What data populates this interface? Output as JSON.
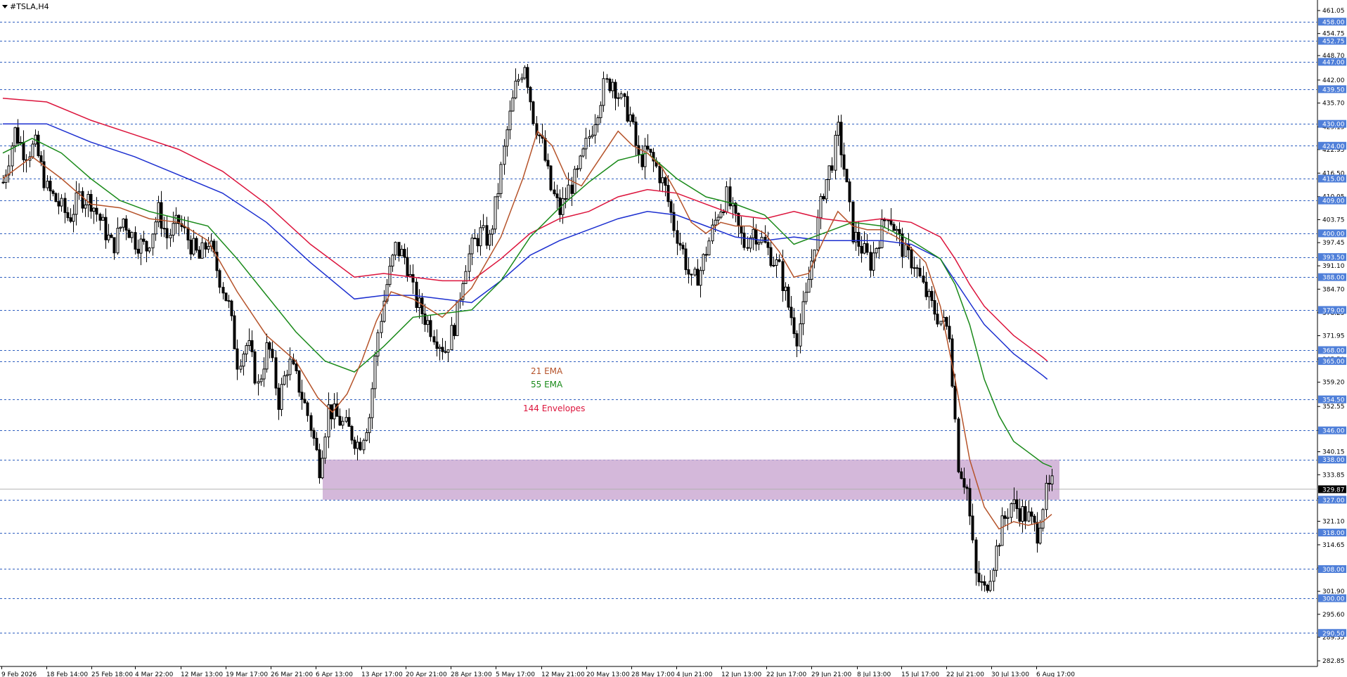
{
  "window": {
    "symbol_title": "#TSLA,H4"
  },
  "colors": {
    "background": "#ffffff",
    "grid_dashed": "#2f5fbf",
    "label_box": "#4f7fd9",
    "ema21": "#b5532a",
    "ema55": "#1a8a1a",
    "env_upper": "#dc143c",
    "env_lower": "#1c2fd0",
    "zone": "#c9a6d1",
    "candle": "#000000"
  },
  "chart_data": {
    "type": "candlestick",
    "symbol": "#TSLA",
    "timeframe": "H4",
    "ylim": [
      282.85,
      461.05
    ],
    "price_axis_ticks": [
      "461.05",
      "454.75",
      "448.70",
      "442.00",
      "435.70",
      "429.15",
      "422.95",
      "416.50",
      "410.05",
      "403.75",
      "397.45",
      "391.10",
      "384.70",
      "378.25",
      "371.95",
      "365.50",
      "359.20",
      "352.55",
      "346.00",
      "340.15",
      "333.85",
      "327.35",
      "321.10",
      "314.65",
      "308.30",
      "301.90",
      "295.60",
      "289.35",
      "282.85"
    ],
    "horizontal_levels": [
      "458.00",
      "452.75",
      "447.00",
      "439.50",
      "430.00",
      "424.00",
      "415.00",
      "409.00",
      "400.00",
      "393.50",
      "388.00",
      "379.00",
      "368.00",
      "365.00",
      "354.50",
      "346.00",
      "338.00",
      "327.00",
      "318.00",
      "308.00",
      "300.00",
      "290.50"
    ],
    "current_price": "329.87",
    "time_axis_labels": [
      "9 Feb 2026",
      "18 Feb 14:00",
      "25 Feb 18:00",
      "4 Mar 22:00",
      "12 Mar 13:00",
      "19 Mar 17:00",
      "26 Mar 21:00",
      "6 Apr 13:00",
      "13 Apr 17:00",
      "20 Apr 21:00",
      "28 Apr 13:00",
      "5 May 17:00",
      "12 May 21:00",
      "20 May 13:00",
      "28 May 17:00",
      "4 Jun 21:00",
      "12 Jun 13:00",
      "22 Jun 17:00",
      "29 Jun 21:00",
      "8 Jul 13:00",
      "15 Jul 17:00",
      "22 Jul 21:00",
      "30 Jul 13:00",
      "6 Aug 17:00"
    ],
    "zone": {
      "price_low": 327.0,
      "price_high": 338.0
    },
    "legend": [
      {
        "text": "21 EMA",
        "color": "#b5532a"
      },
      {
        "text": "55 EMA",
        "color": "#1a8a1a"
      },
      {
        "text": "144 Envelopes",
        "color": "#dc143c"
      }
    ],
    "price_path": [
      [
        0,
        414
      ],
      [
        8,
        428
      ],
      [
        15,
        422
      ],
      [
        22,
        424
      ],
      [
        30,
        412
      ],
      [
        38,
        408
      ],
      [
        45,
        404
      ],
      [
        52,
        410
      ],
      [
        60,
        409
      ],
      [
        68,
        402
      ],
      [
        75,
        396
      ],
      [
        82,
        404
      ],
      [
        90,
        398
      ],
      [
        98,
        396
      ],
      [
        106,
        406
      ],
      [
        112,
        399
      ],
      [
        120,
        403
      ],
      [
        128,
        397
      ],
      [
        134,
        393
      ],
      [
        140,
        398
      ],
      [
        147,
        389
      ],
      [
        154,
        380
      ],
      [
        160,
        365
      ],
      [
        167,
        370
      ],
      [
        174,
        358
      ],
      [
        181,
        370
      ],
      [
        188,
        354
      ],
      [
        195,
        365
      ],
      [
        202,
        358
      ],
      [
        209,
        349
      ],
      [
        216,
        336
      ],
      [
        222,
        352
      ],
      [
        229,
        349
      ],
      [
        236,
        346
      ],
      [
        243,
        342
      ],
      [
        250,
        350
      ],
      [
        256,
        373
      ],
      [
        262,
        386
      ],
      [
        268,
        396
      ],
      [
        275,
        393
      ],
      [
        281,
        382
      ],
      [
        288,
        377
      ],
      [
        295,
        372
      ],
      [
        302,
        368
      ],
      [
        309,
        376
      ],
      [
        315,
        391
      ],
      [
        321,
        397
      ],
      [
        326,
        400
      ],
      [
        332,
        398
      ],
      [
        338,
        412
      ],
      [
        344,
        428
      ],
      [
        350,
        440
      ],
      [
        356,
        447
      ],
      [
        362,
        432
      ],
      [
        368,
        424
      ],
      [
        374,
        412
      ],
      [
        380,
        406
      ],
      [
        386,
        412
      ],
      [
        392,
        416
      ],
      [
        398,
        424
      ],
      [
        404,
        432
      ],
      [
        410,
        440
      ],
      [
        416,
        442
      ],
      [
        422,
        436
      ],
      [
        428,
        432
      ],
      [
        434,
        420
      ],
      [
        440,
        422
      ],
      [
        446,
        418
      ],
      [
        452,
        412
      ],
      [
        458,
        402
      ],
      [
        464,
        395
      ],
      [
        470,
        386
      ],
      [
        476,
        390
      ],
      [
        482,
        398
      ],
      [
        488,
        406
      ],
      [
        494,
        410
      ],
      [
        500,
        403
      ],
      [
        506,
        397
      ],
      [
        512,
        401
      ],
      [
        518,
        398
      ],
      [
        524,
        394
      ],
      [
        530,
        390
      ],
      [
        536,
        380
      ],
      [
        542,
        372
      ],
      [
        548,
        382
      ],
      [
        554,
        398
      ],
      [
        560,
        412
      ],
      [
        566,
        420
      ],
      [
        570,
        428
      ],
      [
        574,
        418
      ],
      [
        580,
        400
      ],
      [
        586,
        396
      ],
      [
        592,
        392
      ],
      [
        598,
        399
      ],
      [
        604,
        406
      ],
      [
        610,
        400
      ],
      [
        616,
        394
      ],
      [
        622,
        392
      ],
      [
        628,
        385
      ],
      [
        634,
        380
      ],
      [
        640,
        376
      ],
      [
        646,
        373
      ],
      [
        652,
        337
      ],
      [
        658,
        330
      ],
      [
        664,
        306
      ],
      [
        670,
        302
      ],
      [
        676,
        310
      ],
      [
        682,
        320
      ],
      [
        688,
        326
      ],
      [
        694,
        324
      ],
      [
        700,
        322
      ],
      [
        706,
        318
      ],
      [
        711,
        328
      ],
      [
        716,
        331
      ]
    ],
    "ema21": [
      [
        0,
        415
      ],
      [
        20,
        421
      ],
      [
        40,
        415
      ],
      [
        60,
        408
      ],
      [
        80,
        407
      ],
      [
        100,
        404
      ],
      [
        120,
        403
      ],
      [
        140,
        398
      ],
      [
        160,
        384
      ],
      [
        180,
        372
      ],
      [
        200,
        365
      ],
      [
        215,
        355
      ],
      [
        225,
        351
      ],
      [
        235,
        356
      ],
      [
        245,
        365
      ],
      [
        255,
        376
      ],
      [
        265,
        384
      ],
      [
        280,
        382
      ],
      [
        300,
        377
      ],
      [
        320,
        385
      ],
      [
        340,
        399
      ],
      [
        355,
        415
      ],
      [
        365,
        428
      ],
      [
        375,
        424
      ],
      [
        385,
        415
      ],
      [
        395,
        413
      ],
      [
        410,
        422
      ],
      [
        420,
        428
      ],
      [
        430,
        424
      ],
      [
        440,
        422
      ],
      [
        450,
        418
      ],
      [
        460,
        411
      ],
      [
        470,
        403
      ],
      [
        480,
        400
      ],
      [
        490,
        403
      ],
      [
        500,
        402
      ],
      [
        510,
        402
      ],
      [
        520,
        400
      ],
      [
        530,
        395
      ],
      [
        540,
        388
      ],
      [
        550,
        389
      ],
      [
        560,
        398
      ],
      [
        570,
        406
      ],
      [
        580,
        402
      ],
      [
        590,
        401
      ],
      [
        600,
        401
      ],
      [
        610,
        399
      ],
      [
        620,
        396
      ],
      [
        630,
        392
      ],
      [
        640,
        380
      ],
      [
        650,
        360
      ],
      [
        660,
        338
      ],
      [
        670,
        325
      ],
      [
        680,
        319
      ],
      [
        690,
        321
      ],
      [
        700,
        320
      ],
      [
        710,
        321
      ],
      [
        716,
        323
      ]
    ],
    "ema55": [
      [
        0,
        422
      ],
      [
        20,
        426
      ],
      [
        40,
        422
      ],
      [
        60,
        415
      ],
      [
        80,
        409
      ],
      [
        100,
        406
      ],
      [
        120,
        404
      ],
      [
        140,
        402
      ],
      [
        160,
        393
      ],
      [
        180,
        383
      ],
      [
        200,
        373
      ],
      [
        220,
        365
      ],
      [
        240,
        362
      ],
      [
        260,
        369
      ],
      [
        280,
        377
      ],
      [
        300,
        378
      ],
      [
        320,
        379
      ],
      [
        340,
        387
      ],
      [
        360,
        399
      ],
      [
        380,
        407
      ],
      [
        400,
        414
      ],
      [
        420,
        420
      ],
      [
        440,
        422
      ],
      [
        460,
        415
      ],
      [
        480,
        410
      ],
      [
        500,
        408
      ],
      [
        520,
        405
      ],
      [
        540,
        397
      ],
      [
        560,
        400
      ],
      [
        580,
        403
      ],
      [
        600,
        402
      ],
      [
        620,
        398
      ],
      [
        640,
        393
      ],
      [
        650,
        386
      ],
      [
        660,
        375
      ],
      [
        670,
        360
      ],
      [
        680,
        350
      ],
      [
        690,
        343
      ],
      [
        700,
        340
      ],
      [
        710,
        337
      ],
      [
        716,
        336
      ]
    ],
    "env_upper": [
      [
        0,
        437
      ],
      [
        30,
        436
      ],
      [
        60,
        431
      ],
      [
        90,
        427
      ],
      [
        120,
        423
      ],
      [
        150,
        417
      ],
      [
        180,
        408
      ],
      [
        210,
        397
      ],
      [
        240,
        388
      ],
      [
        260,
        389
      ],
      [
        280,
        388
      ],
      [
        300,
        387
      ],
      [
        320,
        387
      ],
      [
        340,
        393
      ],
      [
        360,
        400
      ],
      [
        380,
        404
      ],
      [
        400,
        406
      ],
      [
        420,
        410
      ],
      [
        440,
        412
      ],
      [
        460,
        411
      ],
      [
        480,
        408
      ],
      [
        500,
        405
      ],
      [
        520,
        404
      ],
      [
        540,
        406
      ],
      [
        560,
        404
      ],
      [
        580,
        403
      ],
      [
        600,
        404
      ],
      [
        620,
        403
      ],
      [
        640,
        399
      ],
      [
        650,
        393
      ],
      [
        660,
        386
      ],
      [
        670,
        380
      ],
      [
        680,
        376
      ],
      [
        690,
        372
      ],
      [
        700,
        369
      ],
      [
        710,
        366
      ],
      [
        713,
        365
      ]
    ],
    "env_lower": [
      [
        0,
        430
      ],
      [
        30,
        430
      ],
      [
        60,
        425
      ],
      [
        90,
        421
      ],
      [
        120,
        416
      ],
      [
        150,
        411
      ],
      [
        180,
        403
      ],
      [
        210,
        392
      ],
      [
        240,
        382
      ],
      [
        260,
        383
      ],
      [
        280,
        383
      ],
      [
        300,
        382
      ],
      [
        320,
        381
      ],
      [
        340,
        387
      ],
      [
        360,
        394
      ],
      [
        380,
        398
      ],
      [
        400,
        401
      ],
      [
        420,
        404
      ],
      [
        440,
        406
      ],
      [
        460,
        405
      ],
      [
        480,
        402
      ],
      [
        500,
        399
      ],
      [
        520,
        398
      ],
      [
        540,
        399
      ],
      [
        560,
        398
      ],
      [
        580,
        398
      ],
      [
        600,
        398
      ],
      [
        620,
        397
      ],
      [
        640,
        393
      ],
      [
        650,
        387
      ],
      [
        660,
        381
      ],
      [
        670,
        375
      ],
      [
        680,
        371
      ],
      [
        690,
        367
      ],
      [
        700,
        364
      ],
      [
        710,
        361
      ],
      [
        713,
        360
      ]
    ]
  }
}
